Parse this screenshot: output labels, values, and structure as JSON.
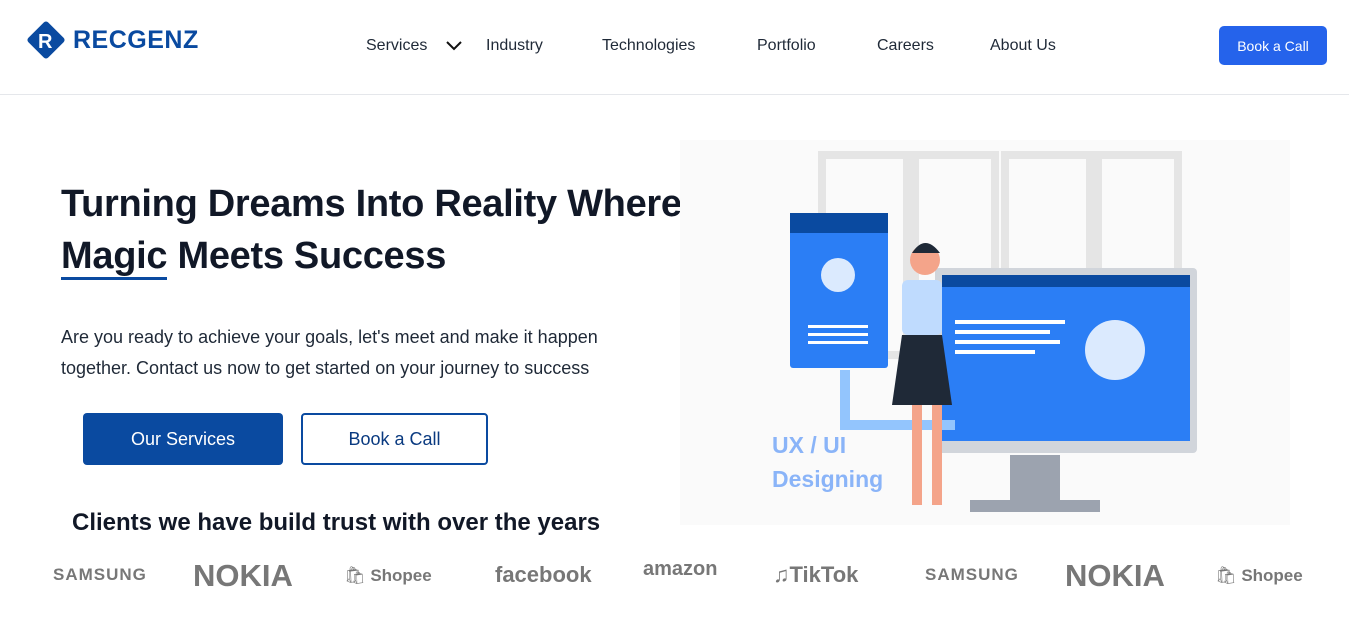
{
  "brand": {
    "name": "RECGENZ",
    "color": "#0a4aa0"
  },
  "nav": {
    "items": [
      "Services",
      "Industry",
      "Technologies",
      "Portfolio",
      "Careers",
      "About Us"
    ],
    "cta": "Book a Call"
  },
  "hero": {
    "title_line1": "Turning Dreams Into Reality Where",
    "title_word_underlined": "Magic",
    "title_rest": " Meets Success",
    "description": "Are you ready to achieve your goals, let's meet and make it happen together. Contact us now to get started on your journey to success",
    "primary_button": "Our Services",
    "secondary_button": "Book a Call"
  },
  "illustration": {
    "line1": "UX / UI",
    "line2": "Designing"
  },
  "clients": {
    "heading": "Clients we have build trust with over the years",
    "logos": [
      "SAMSUNG",
      "NOKIA",
      "Shopee",
      "facebook",
      "amazon",
      "TikTok",
      "SAMSUNG",
      "NOKIA",
      "Shopee"
    ]
  }
}
